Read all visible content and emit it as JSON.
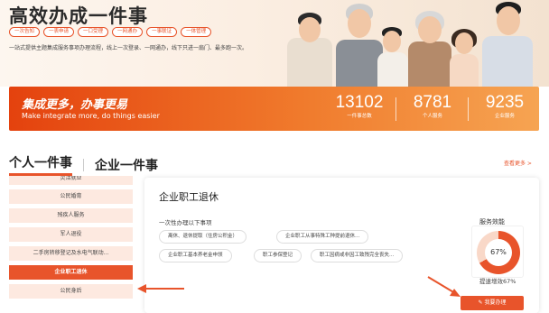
{
  "hero": {
    "title": "高效办成一件事",
    "tags": [
      "一次告知",
      "一表申请",
      "一口受理",
      "一网通办",
      "一事联证",
      "一体管理"
    ],
    "desc": "一站式提供主题集成服务事项办理流程，线上一次登录、一网通办，线下只进一扇门、最多跑一次。"
  },
  "stats": {
    "slogan": "集成更多，办事更易",
    "slogan_en": "Make integrate more, do things easier",
    "items": [
      {
        "value": "13102",
        "label": "一件事总数"
      },
      {
        "value": "8781",
        "label": "个人服务"
      },
      {
        "value": "9235",
        "label": "企业服务"
      }
    ]
  },
  "tabs": {
    "personal": "个人一件事",
    "enterprise": "企业一件事",
    "more": "查看更多 >"
  },
  "side_items": [
    "灵活就业",
    "公民婚育",
    "残疾人服务",
    "军人退役",
    "二手房转移登记及水电气联动...",
    "企业职工退休",
    "公民身后"
  ],
  "panel": {
    "title": "企业职工退休",
    "subtitle": "一次性办理以下事项",
    "chips": [
      "离休、退休提取（住房公积金）",
      "企业职工从事特殊工种提前退休...",
      "企业职工基本养老金申领",
      "职工参保登记",
      "职工因病或非因工致残完全丧失..."
    ],
    "efficiency_title": "服务效能",
    "efficiency_value": "67%",
    "efficiency_text": "提速增效67%",
    "apply_label": "我要办理"
  },
  "colors": {
    "accent": "#e8542b",
    "accent_light": "#fde9e0"
  }
}
